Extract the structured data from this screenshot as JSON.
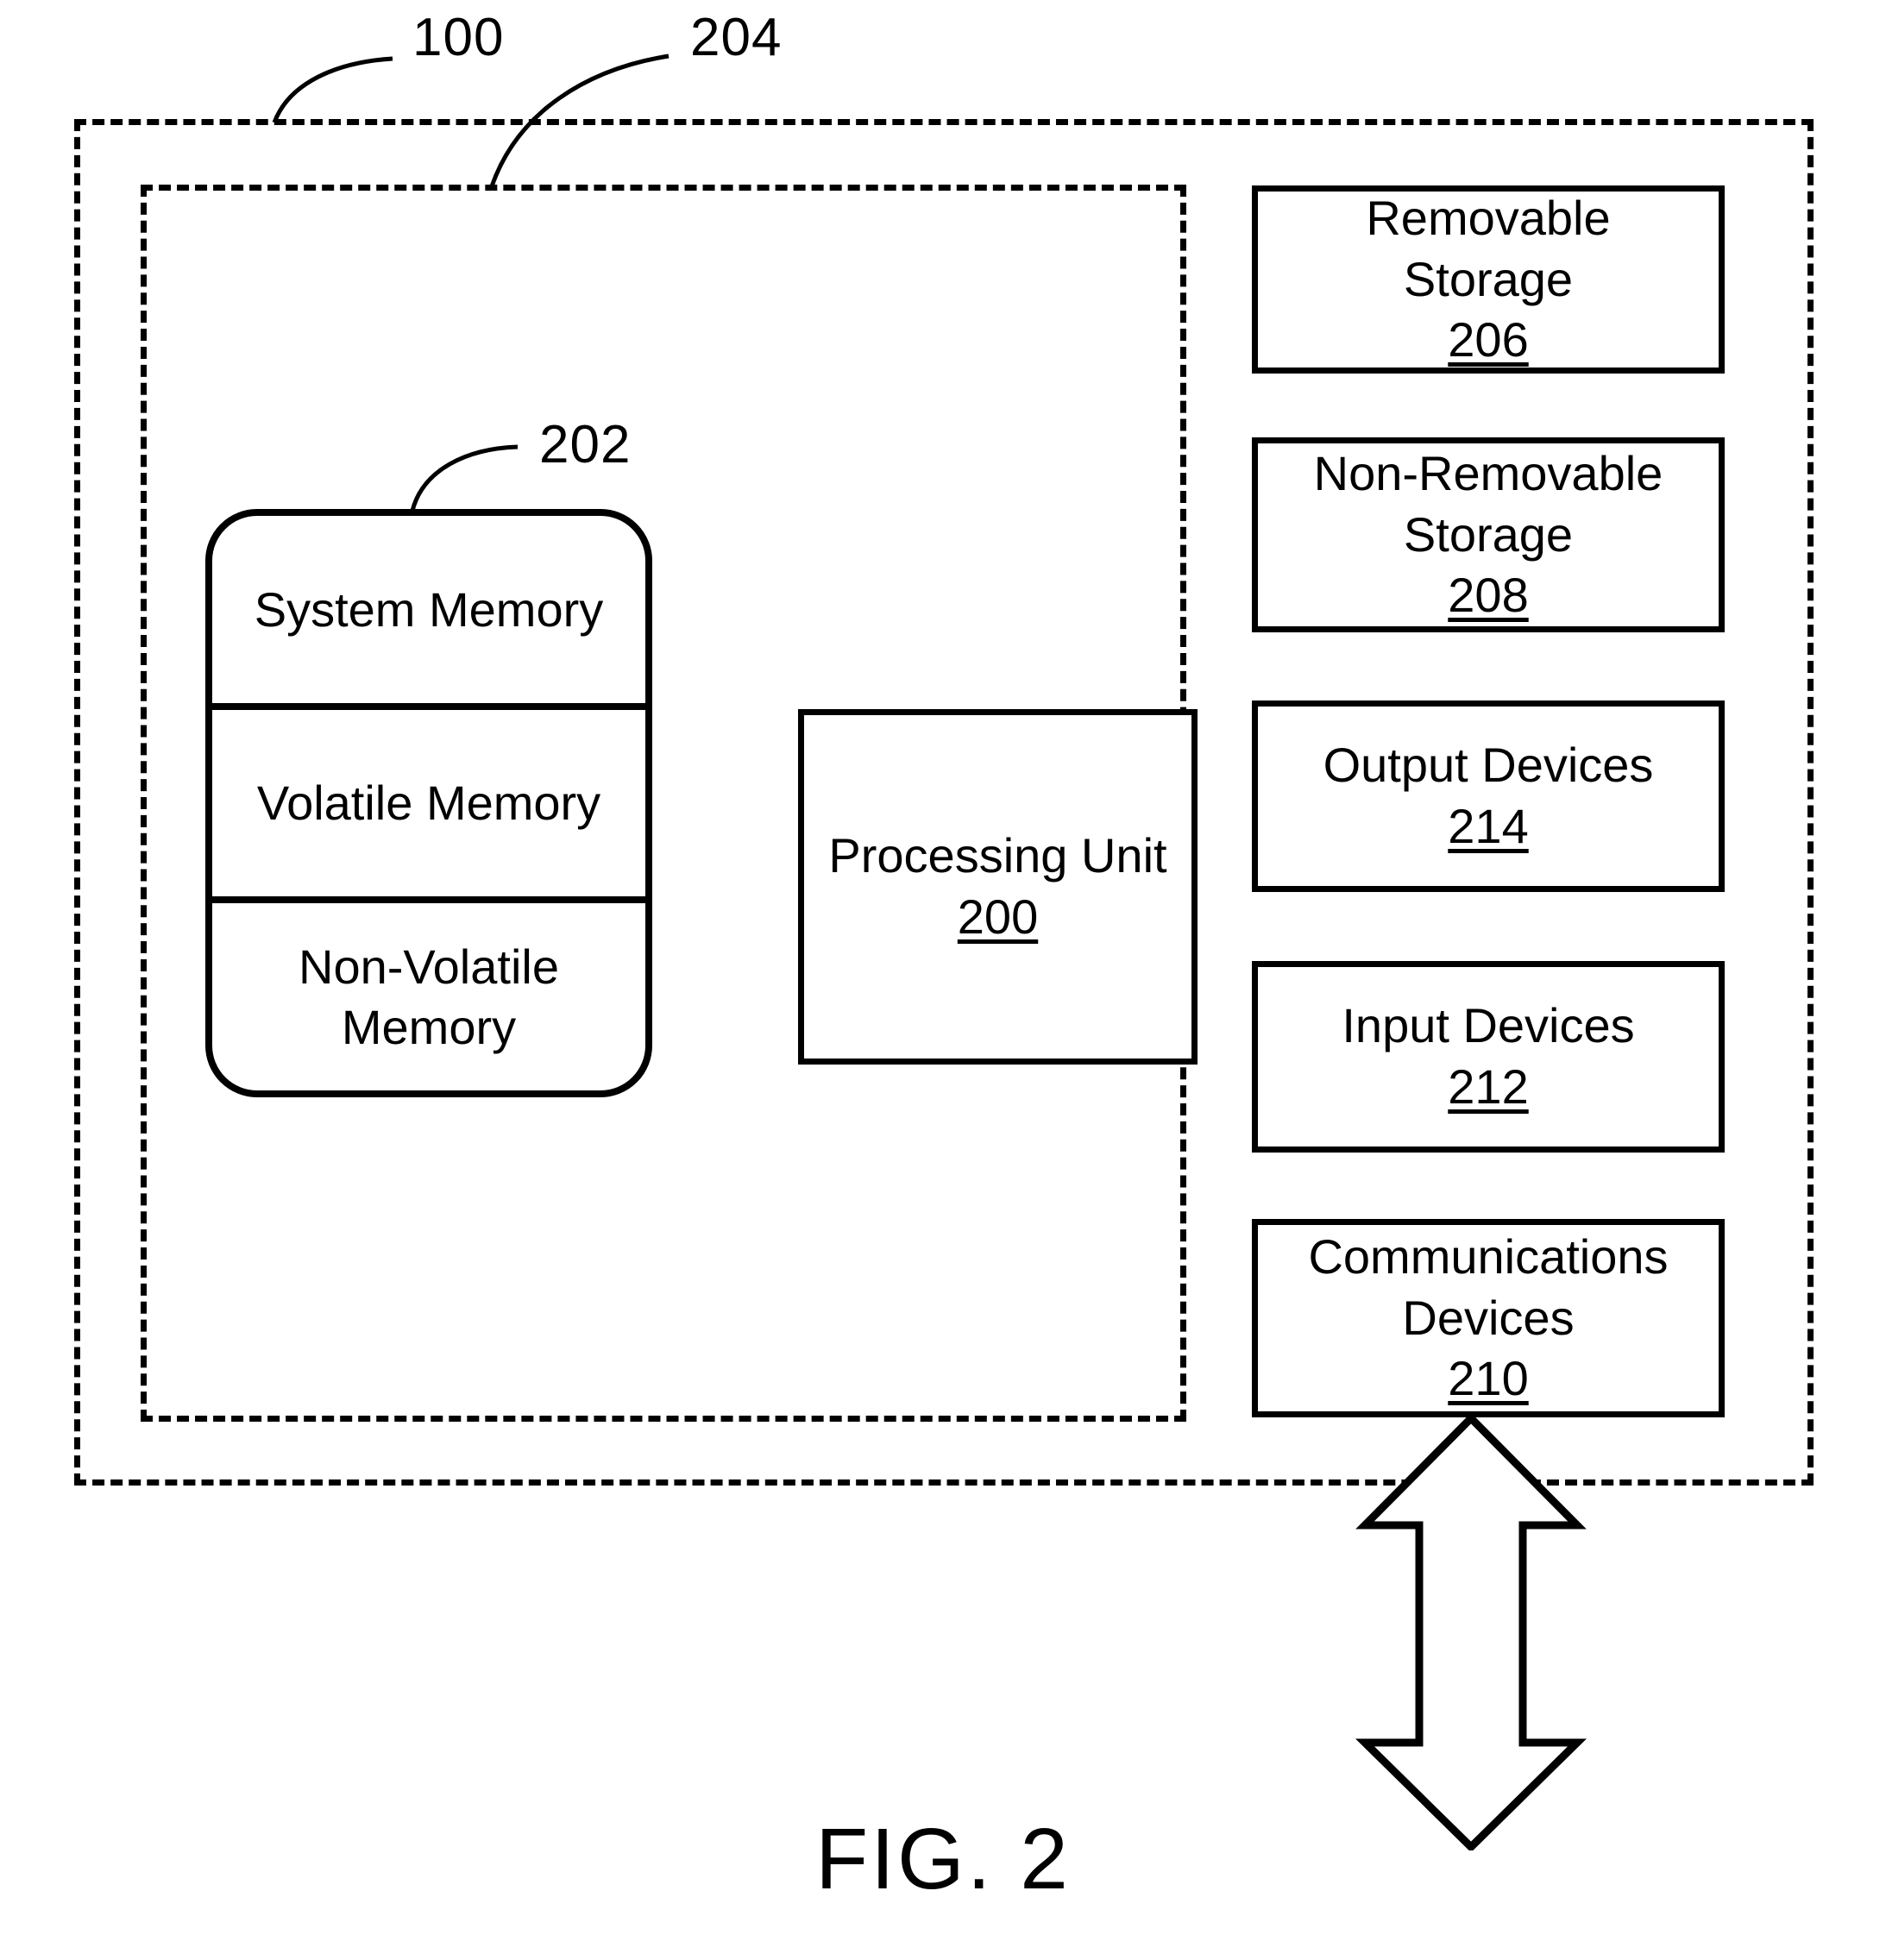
{
  "figure": {
    "caption": "FIG. 2",
    "callouts": [
      {
        "id": "100",
        "label": "100"
      },
      {
        "id": "204",
        "label": "204"
      },
      {
        "id": "202",
        "label": "202"
      }
    ]
  },
  "memory_stack": {
    "reference": "202",
    "cells": [
      {
        "label": "System Memory"
      },
      {
        "label": "Volatile Memory"
      },
      {
        "label_line1": "Non-Volatile",
        "label_line2": "Memory"
      }
    ]
  },
  "processing_unit": {
    "label": "Processing Unit",
    "reference": "200"
  },
  "peripherals": [
    {
      "line1": "Removable",
      "line2": "Storage",
      "reference": "206"
    },
    {
      "line1": "Non-Removable",
      "line2": "Storage",
      "reference": "208"
    },
    {
      "line1": "Output Devices",
      "line2": "",
      "reference": "214"
    },
    {
      "line1": "Input Devices",
      "line2": "",
      "reference": "212"
    },
    {
      "line1": "Communications",
      "line2": "Devices",
      "reference": "210"
    }
  ],
  "colors": {
    "ink": "#000000",
    "paper": "#ffffff"
  }
}
